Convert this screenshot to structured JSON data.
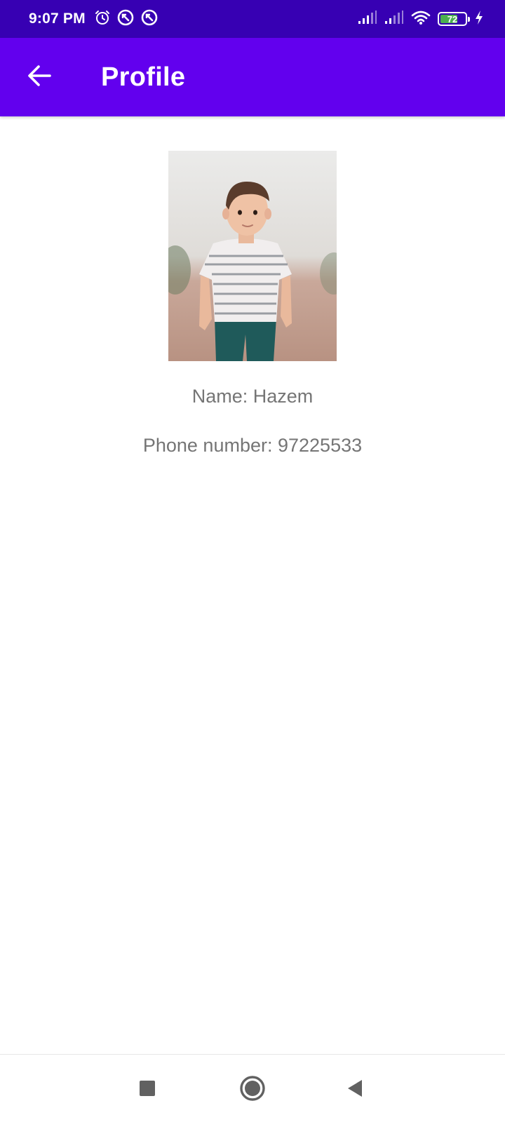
{
  "status_bar": {
    "time": "9:07 PM",
    "left_icons": [
      "alarm-icon",
      "sync-off-icon",
      "sync-off-icon"
    ],
    "right_icons": [
      "signal-icon",
      "signal-icon",
      "wifi-icon",
      "battery-icon",
      "charging-icon"
    ],
    "battery_level": "72"
  },
  "app_bar": {
    "title": "Profile",
    "back_icon": "arrow-back-icon"
  },
  "profile": {
    "name_line": "Name: Hazem",
    "phone_line": "Phone number: 97225533"
  },
  "nav_bar": {
    "buttons": [
      "recents-icon",
      "home-icon",
      "back-icon"
    ]
  },
  "colors": {
    "status_bar": "#3700b3",
    "app_bar": "#6200ee",
    "text_secondary": "#757575",
    "battery_fill": "#4caf50"
  }
}
